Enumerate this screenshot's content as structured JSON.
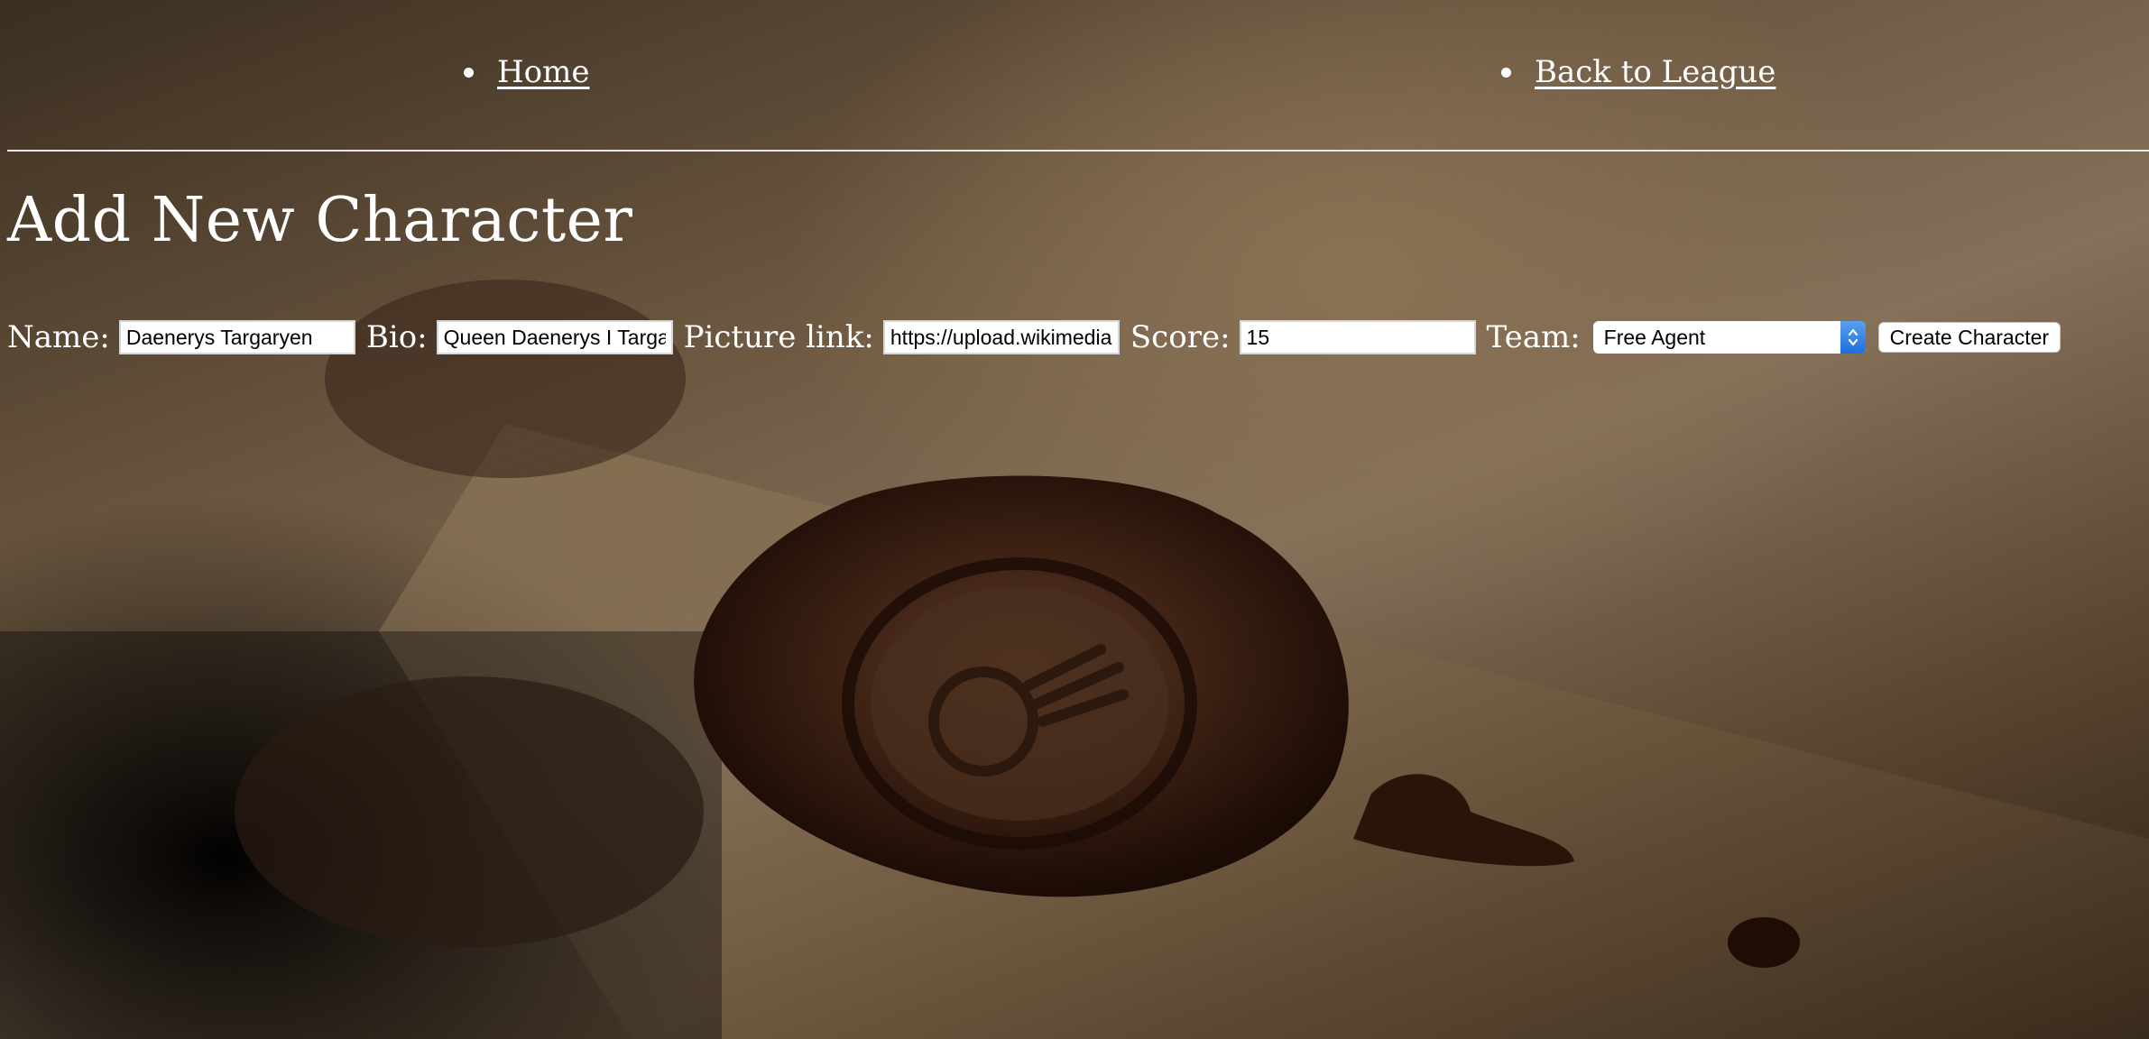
{
  "nav": {
    "home_label": "Home",
    "league_label": "Back to League"
  },
  "page": {
    "title": "Add New Character"
  },
  "form": {
    "name_label": "Name:",
    "name_value": "Daenerys Targaryen",
    "bio_label": "Bio:",
    "bio_value": "Queen Daenerys I Targa",
    "picture_label": "Picture link:",
    "picture_value": "https://upload.wikimedia",
    "score_label": "Score:",
    "score_value": "15",
    "team_label": "Team:",
    "team_selected": "Free Agent",
    "submit_label": "Create Character"
  },
  "background": {
    "description_icon": "wax-seal-background",
    "colors": {
      "paper": "#85705a",
      "wax": "#2a160c",
      "shadow": "#050302"
    }
  }
}
